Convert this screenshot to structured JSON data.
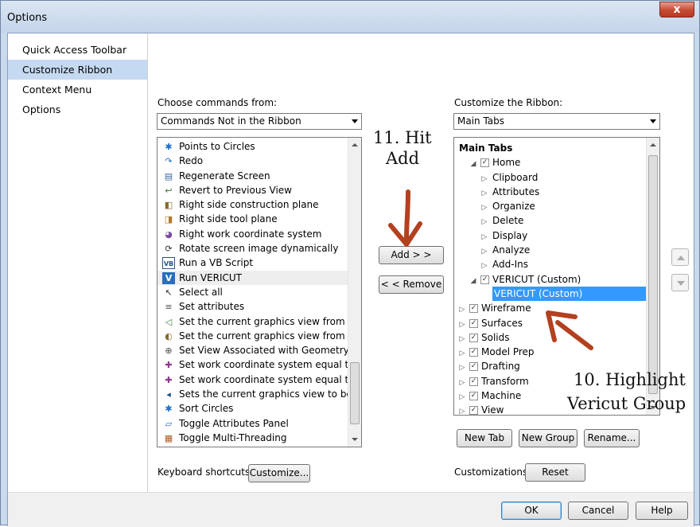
{
  "window": {
    "title": "Options",
    "close_glyph": "x"
  },
  "nav": {
    "items": [
      "Quick Access Toolbar",
      "Customize Ribbon",
      "Context Menu",
      "Options"
    ],
    "selected": 1
  },
  "left": {
    "choose_label": "Choose commands from:",
    "choose_value": "Commands Not in the Ribbon",
    "commands": [
      {
        "label": "Points to Circles",
        "icon": "points-to-circles-icon"
      },
      {
        "label": "Redo",
        "icon": "redo-icon"
      },
      {
        "label": "Regenerate Screen",
        "icon": "regenerate-screen-icon"
      },
      {
        "label": "Revert to Previous View",
        "icon": "revert-view-icon"
      },
      {
        "label": "Right side construction plane",
        "icon": "construction-plane-icon"
      },
      {
        "label": "Right side tool plane",
        "icon": "tool-plane-icon"
      },
      {
        "label": "Right work coordinate system",
        "icon": "work-coordinate-icon"
      },
      {
        "label": "Rotate screen image dynamically",
        "icon": "rotate-icon"
      },
      {
        "label": "Run a VB Script",
        "icon": "vb-script-icon"
      },
      {
        "label": "Run VERICUT",
        "icon": "vericut-icon"
      },
      {
        "label": "Select all",
        "icon": "select-all-icon"
      },
      {
        "label": "Set attributes",
        "icon": "set-attributes-icon"
      },
      {
        "label": "Set the current graphics view from a sele",
        "icon": "graphics-view-icon"
      },
      {
        "label": "Set the current graphics view from a solic",
        "icon": "graphics-view-solid-icon"
      },
      {
        "label": "Set View Associated with Geometry...",
        "icon": "view-geometry-icon"
      },
      {
        "label": "Set work coordinate system equal to con",
        "icon": "wcs-construction-icon"
      },
      {
        "label": "Set work coordinate system equal to tool",
        "icon": "wcs-tool-icon"
      },
      {
        "label": "Sets the current graphics view to be nom",
        "icon": "graphics-view-normal-icon"
      },
      {
        "label": "Sort Circles",
        "icon": "sort-circles-icon"
      },
      {
        "label": "Toggle Attributes Panel",
        "icon": "toggle-attributes-icon"
      },
      {
        "label": "Toggle Multi-Threading",
        "icon": "multi-threading-icon"
      }
    ],
    "highlighted_index": 9,
    "keyboard_label": "Keyboard shortcuts:",
    "customize_button": "Customize..."
  },
  "middle": {
    "add_button": "Add > >",
    "remove_button": "< < Remove"
  },
  "right": {
    "customize_label": "Customize the Ribbon:",
    "customize_value": "Main Tabs",
    "tree": [
      {
        "label": "Main Tabs",
        "level": 0,
        "header": true
      },
      {
        "label": "Home",
        "level": 1,
        "expander": "◢",
        "check": true
      },
      {
        "label": "Clipboard",
        "level": 2,
        "expander": "▷"
      },
      {
        "label": "Attributes",
        "level": 2,
        "expander": "▷"
      },
      {
        "label": "Organize",
        "level": 2,
        "expander": "▷"
      },
      {
        "label": "Delete",
        "level": 2,
        "expander": "▷"
      },
      {
        "label": "Display",
        "level": 2,
        "expander": "▷"
      },
      {
        "label": "Analyze",
        "level": 2,
        "expander": "▷"
      },
      {
        "label": "Add-Ins",
        "level": 2,
        "expander": "▷"
      },
      {
        "label": "VERICUT (Custom)",
        "level": 1,
        "expander": "◢",
        "check": true
      },
      {
        "label": "VERICUT (Custom)",
        "level": 2,
        "selected": true
      },
      {
        "label": "Wireframe",
        "level": 0,
        "expander": "▷",
        "check": true
      },
      {
        "label": "Surfaces",
        "level": 0,
        "expander": "▷",
        "check": true
      },
      {
        "label": "Solids",
        "level": 0,
        "expander": "▷",
        "check": true
      },
      {
        "label": "Model Prep",
        "level": 0,
        "expander": "▷",
        "check": true
      },
      {
        "label": "Drafting",
        "level": 0,
        "expander": "▷",
        "check": true
      },
      {
        "label": "Transform",
        "level": 0,
        "expander": "▷",
        "check": true
      },
      {
        "label": "Machine",
        "level": 0,
        "expander": "▷",
        "check": true
      },
      {
        "label": "View",
        "level": 0,
        "expander": "▷",
        "check": true
      }
    ],
    "new_tab_button": "New Tab",
    "new_group_button": "New Group",
    "rename_button": "Rename...",
    "customizations_label": "Customizations:",
    "reset_button": "Reset"
  },
  "footer": {
    "ok": "OK",
    "cancel": "Cancel",
    "help": "Help"
  },
  "annotations": {
    "step11_line1": "11. Hit",
    "step11_line2": "Add",
    "step10_line1": "10. Highlight",
    "step10_line2": "Vericut Group"
  },
  "colors": {
    "selection_blue": "#3399ff",
    "nav_selected": "#c5d9f1",
    "arrow_red": "#b3401f"
  }
}
